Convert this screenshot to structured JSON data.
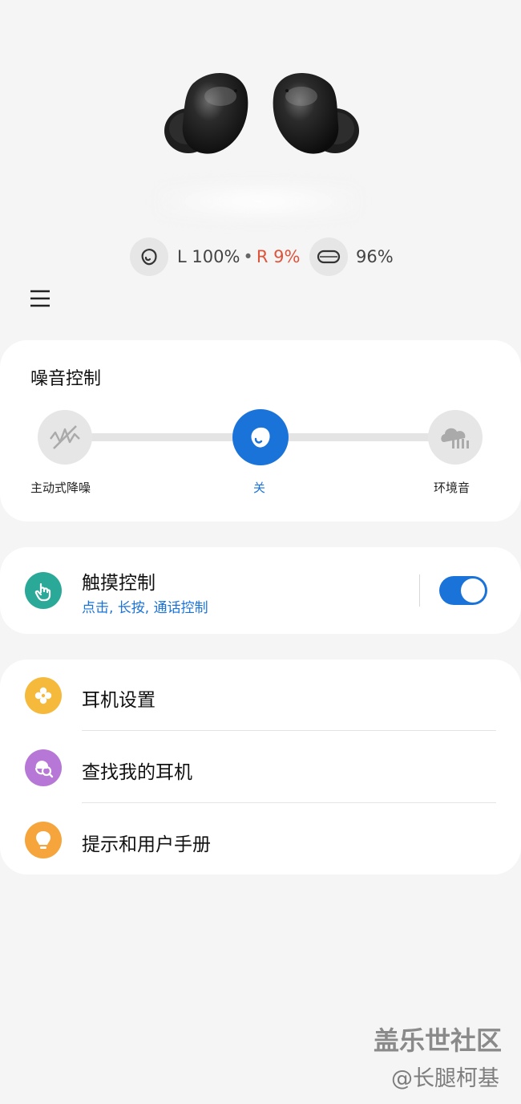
{
  "battery": {
    "left_label": "L 100%",
    "separator": "•",
    "right_label": "R 9%",
    "case_label": "96%"
  },
  "noise_control": {
    "title": "噪音控制",
    "options": [
      {
        "label": "主动式降噪",
        "icon": "anc-icon",
        "active": false
      },
      {
        "label": "关",
        "icon": "earbud-icon",
        "active": true
      },
      {
        "label": "环境音",
        "icon": "ambient-sound-icon",
        "active": false
      }
    ]
  },
  "touch_control": {
    "title": "触摸控制",
    "subtitle": "点击, 长按, 通话控制",
    "enabled": true,
    "icon": "touch-hand-icon",
    "icon_color": "#2aa898"
  },
  "menu": {
    "items": [
      {
        "label": "耳机设置",
        "icon": "settings-flower-icon",
        "color": "#f5b93b"
      },
      {
        "label": "查找我的耳机",
        "icon": "find-earbuds-icon",
        "color": "#b677d6"
      },
      {
        "label": "提示和用户手册",
        "icon": "lightbulb-icon",
        "color": "#f5a53b"
      }
    ]
  },
  "watermark": {
    "line1": "盖乐世社区",
    "line2": "@长腿柯基"
  },
  "colors": {
    "accent": "#1a73d9",
    "battery_low": "#e0533b"
  }
}
